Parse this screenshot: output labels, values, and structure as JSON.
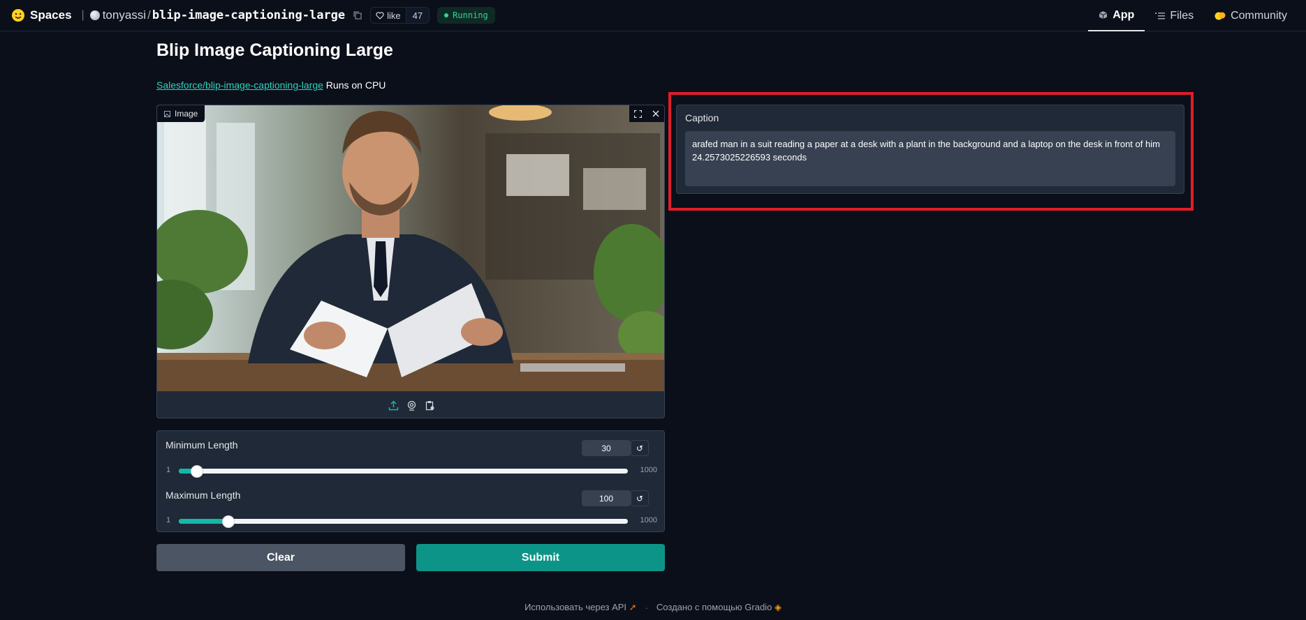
{
  "header": {
    "brand": "Spaces",
    "owner": "tonyassi",
    "repo": "blip-image-captioning-large",
    "like_label": "like",
    "like_count": "47",
    "status": "Running",
    "nav": [
      {
        "label": "App",
        "icon": "cube-icon"
      },
      {
        "label": "Files",
        "icon": "files-icon"
      },
      {
        "label": "Community",
        "icon": "community-icon"
      }
    ]
  },
  "page": {
    "title": "Blip Image Captioning Large",
    "model_link": "Salesforce/blip-image-captioning-large",
    "runs_on": "Runs on CPU"
  },
  "image_input": {
    "label": "Image",
    "source_icons": [
      "upload-icon",
      "webcam-icon",
      "clipboard-icon"
    ]
  },
  "sliders": [
    {
      "label": "Minimum Length",
      "value": "30",
      "min": "1",
      "max": "1000",
      "position": 0.04
    },
    {
      "label": "Maximum Length",
      "value": "100",
      "min": "1",
      "max": "1000",
      "position": 0.11
    }
  ],
  "buttons": {
    "clear": "Clear",
    "submit": "Submit"
  },
  "output": {
    "label": "Caption",
    "caption_line1": "arafed man in a suit reading a paper at a desk with a plant in the background and a laptop on the desk in front of him",
    "caption_line2": "24.2573025226593 seconds"
  },
  "footer": {
    "api": "Использовать через API",
    "built_with": "Создано с помощью Gradio"
  },
  "colors": {
    "accent": "#0d9488",
    "highlight": "#e11d2a",
    "status": "#34d399"
  }
}
